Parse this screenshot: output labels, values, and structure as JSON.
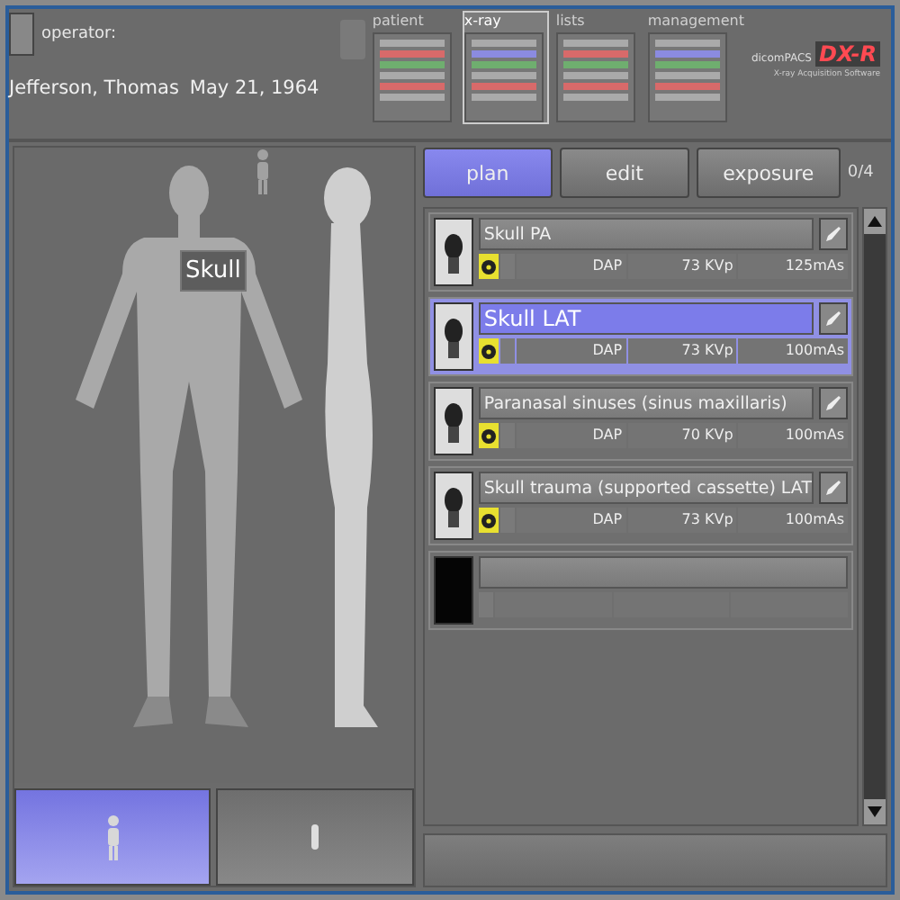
{
  "operator": {
    "label": "operator:"
  },
  "patient": {
    "name": "Jefferson, Thomas",
    "birth_date": "May 21, 1964"
  },
  "nav": [
    {
      "label": "patient",
      "selected": false
    },
    {
      "label": "x-ray",
      "selected": true
    },
    {
      "label": "lists",
      "selected": false
    },
    {
      "label": "management",
      "selected": false
    }
  ],
  "logo": {
    "brand": "dicomPACS",
    "product": "DX-R",
    "subtitle": "X-ray Acquisition Software"
  },
  "body_map": {
    "region_label": "Skull"
  },
  "views": [
    {
      "kind": "front",
      "selected": true
    },
    {
      "kind": "side",
      "selected": false
    }
  ],
  "tabs": [
    {
      "label": "plan",
      "selected": true
    },
    {
      "label": "edit",
      "selected": false
    },
    {
      "label": "exposure",
      "selected": false
    }
  ],
  "counter": "0/4",
  "exams": [
    {
      "name": "Skull PA",
      "selected": false,
      "dose": "DAP",
      "kvp": "73 KVp",
      "mas": "125mAs"
    },
    {
      "name": "Skull LAT",
      "selected": true,
      "dose": "DAP",
      "kvp": "73 KVp",
      "mas": "100mAs"
    },
    {
      "name": "Paranasal sinuses (sinus maxillaris)",
      "selected": false,
      "dose": "DAP",
      "kvp": "70 KVp",
      "mas": "100mAs"
    },
    {
      "name": "Skull trauma (supported cassette) LAT",
      "selected": false,
      "dose": "DAP",
      "kvp": "73 KVp",
      "mas": "100mAs"
    }
  ]
}
